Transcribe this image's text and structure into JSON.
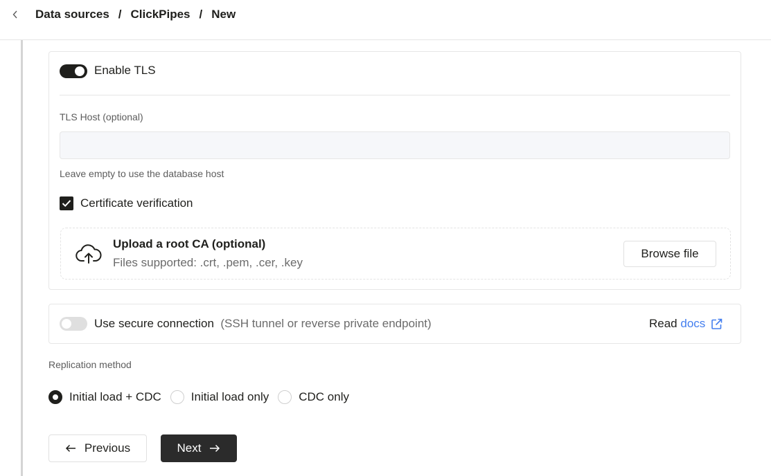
{
  "breadcrumb": {
    "items": [
      "Data sources",
      "ClickPipes",
      "New"
    ],
    "separator": "/"
  },
  "tls": {
    "toggle_label": "Enable TLS",
    "enabled": true,
    "host_label": "TLS Host (optional)",
    "host_value": "",
    "host_help": "Leave empty to use the database host",
    "cert_verification_label": "Certificate verification",
    "cert_verification_checked": true,
    "upload": {
      "title": "Upload a root CA (optional)",
      "subtitle": "Files supported: .crt, .pem, .cer, .key",
      "browse_label": "Browse file"
    }
  },
  "secure_connection": {
    "label": "Use secure connection",
    "hint": "(SSH tunnel or reverse private endpoint)",
    "enabled": false,
    "read_label": "Read",
    "docs_label": "docs"
  },
  "replication": {
    "label": "Replication method",
    "options": [
      "Initial load + CDC",
      "Initial load only",
      "CDC only"
    ],
    "selected": "Initial load + CDC"
  },
  "nav": {
    "previous_label": "Previous",
    "next_label": "Next"
  },
  "colors": {
    "accent": "#1f1f1c",
    "link": "#437eef",
    "input_bg": "#f6f7fa"
  }
}
